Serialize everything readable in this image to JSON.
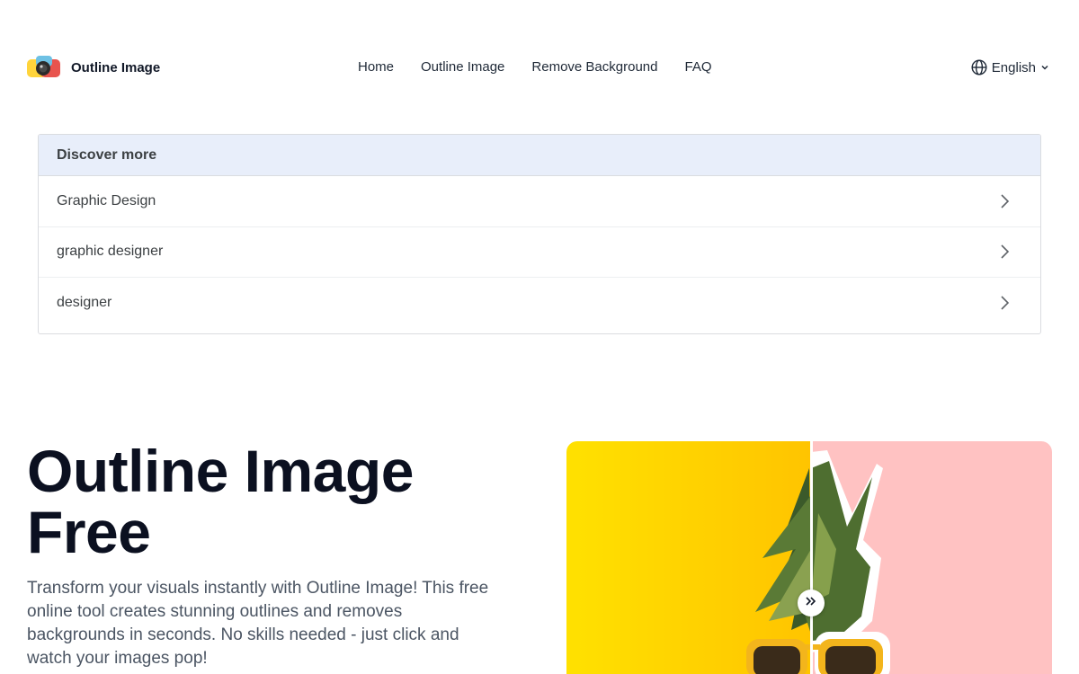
{
  "header": {
    "logo_text": "Outline Image",
    "logo_icon": "camera-logo-icon",
    "nav": [
      {
        "label": "Home"
      },
      {
        "label": "Outline Image"
      },
      {
        "label": "Remove Background"
      },
      {
        "label": "FAQ"
      }
    ],
    "language": {
      "label": "English",
      "icon": "globe-icon"
    }
  },
  "discover": {
    "heading": "Discover more",
    "items": [
      {
        "label": "Graphic Design"
      },
      {
        "label": "graphic designer"
      },
      {
        "label": "designer"
      }
    ]
  },
  "hero": {
    "title_line1": "Outline Image",
    "title_line2": "Free",
    "description": "Transform your visuals instantly with Outline Image! This free online tool creates stunning outlines and removes backgrounds in seconds. No skills needed - just click and watch your images pop!"
  },
  "compare": {
    "left_color": "#ffd000",
    "right_color": "#ffc2c2",
    "divider_percent": 50.4
  },
  "colors": {
    "text_dark": "#111827",
    "panel_header_bg": "#e8eefa"
  }
}
